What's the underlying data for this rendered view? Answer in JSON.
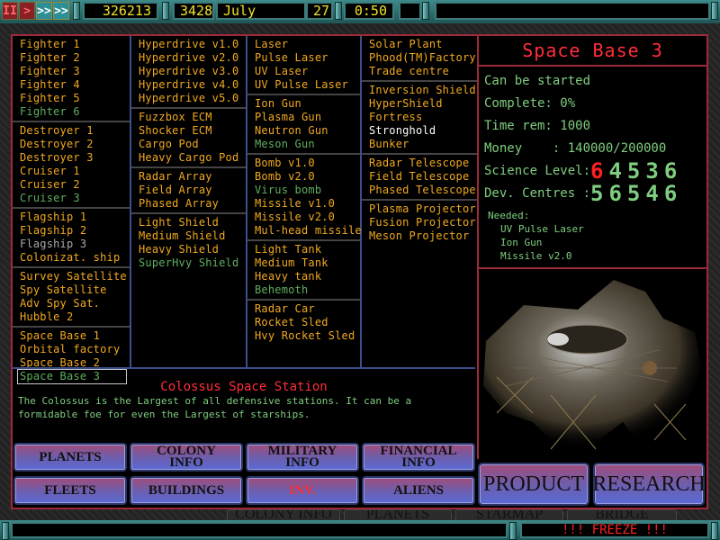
{
  "topbar": {
    "controls": [
      {
        "name": "pause",
        "glyph": "II"
      },
      {
        "name": "play",
        "glyph": ">"
      },
      {
        "name": "fast",
        "glyph": ">>"
      },
      {
        "name": "faster",
        "glyph": ">>"
      }
    ],
    "credits": "326213",
    "year": "3428",
    "month": "July",
    "day": "27",
    "time": "0:50",
    "message": ""
  },
  "columns": [
    {
      "groups": [
        [
          {
            "label": "Fighter 1",
            "state": "available"
          },
          {
            "label": "Fighter 2",
            "state": "available"
          },
          {
            "label": "Fighter 3",
            "state": "available"
          },
          {
            "label": "Fighter 4",
            "state": "available"
          },
          {
            "label": "Fighter 5",
            "state": "available"
          },
          {
            "label": "Fighter 6",
            "state": "researched"
          }
        ],
        [
          {
            "label": "Destroyer 1",
            "state": "available"
          },
          {
            "label": "Destroyer 2",
            "state": "available"
          },
          {
            "label": "Destroyer 3",
            "state": "available"
          },
          {
            "label": "Cruiser 1",
            "state": "available"
          },
          {
            "label": "Cruiser 2",
            "state": "available"
          },
          {
            "label": "Cruiser 3",
            "state": "researched"
          }
        ],
        [
          {
            "label": "Flagship 1",
            "state": "available"
          },
          {
            "label": "Flagship 2",
            "state": "available"
          },
          {
            "label": "Flagship 3",
            "state": "unavailable"
          },
          {
            "label": "Colonizat. ship",
            "state": "available"
          }
        ],
        [
          {
            "label": "Survey Satellite",
            "state": "available"
          },
          {
            "label": "Spy Satellite",
            "state": "available"
          },
          {
            "label": "Adv Spy Sat.",
            "state": "available"
          },
          {
            "label": "Hubble 2",
            "state": "available"
          }
        ],
        [
          {
            "label": "Space Base 1",
            "state": "available"
          },
          {
            "label": "Orbital factory",
            "state": "available"
          },
          {
            "label": "Space Base 2",
            "state": "available"
          },
          {
            "label": "Space Base 3",
            "state": "researched",
            "selected": true
          }
        ]
      ]
    },
    {
      "groups": [
        [
          {
            "label": "Hyperdrive v1.0",
            "state": "available"
          },
          {
            "label": "Hyperdrive v2.0",
            "state": "available"
          },
          {
            "label": "Hyperdrive v3.0",
            "state": "available"
          },
          {
            "label": "Hyperdrive v4.0",
            "state": "available"
          },
          {
            "label": "Hyperdrive v5.0",
            "state": "available"
          }
        ],
        [
          {
            "label": "Fuzzbox ECM",
            "state": "available"
          },
          {
            "label": "Shocker ECM",
            "state": "available"
          },
          {
            "label": "Cargo Pod",
            "state": "available"
          },
          {
            "label": "Heavy Cargo Pod",
            "state": "available"
          }
        ],
        [
          {
            "label": "Radar Array",
            "state": "available"
          },
          {
            "label": "Field Array",
            "state": "available"
          },
          {
            "label": "Phased Array",
            "state": "available"
          }
        ],
        [
          {
            "label": "Light Shield",
            "state": "available"
          },
          {
            "label": "Medium Shield",
            "state": "available"
          },
          {
            "label": "Heavy Shield",
            "state": "available"
          },
          {
            "label": "SuperHvy Shield",
            "state": "researched"
          }
        ]
      ]
    },
    {
      "groups": [
        [
          {
            "label": "Laser",
            "state": "available"
          },
          {
            "label": "Pulse Laser",
            "state": "available"
          },
          {
            "label": "UV Laser",
            "state": "available"
          },
          {
            "label": "UV Pulse Laser",
            "state": "available"
          }
        ],
        [
          {
            "label": "Ion Gun",
            "state": "available"
          },
          {
            "label": "Plasma Gun",
            "state": "available"
          },
          {
            "label": "Neutron Gun",
            "state": "available"
          },
          {
            "label": "Meson Gun",
            "state": "researched"
          }
        ],
        [
          {
            "label": "Bomb v1.0",
            "state": "available"
          },
          {
            "label": "Bomb v2.0",
            "state": "available"
          },
          {
            "label": "Virus bomb",
            "state": "researched"
          },
          {
            "label": "Missile v1.0",
            "state": "available"
          },
          {
            "label": "Missile v2.0",
            "state": "available"
          },
          {
            "label": "Mul-head missile",
            "state": "available"
          }
        ],
        [
          {
            "label": "Light Tank",
            "state": "available"
          },
          {
            "label": "Medium Tank",
            "state": "available"
          },
          {
            "label": "Heavy tank",
            "state": "available"
          },
          {
            "label": "Behemoth",
            "state": "researched"
          }
        ],
        [
          {
            "label": "Radar Car",
            "state": "available"
          },
          {
            "label": "Rocket Sled",
            "state": "available"
          },
          {
            "label": "Hvy Rocket Sled",
            "state": "available"
          }
        ]
      ]
    },
    {
      "groups": [
        [
          {
            "label": "Solar Plant",
            "state": "available"
          },
          {
            "label": "Phood(TM)Factory",
            "state": "available"
          },
          {
            "label": "Trade centre",
            "state": "available"
          }
        ],
        [
          {
            "label": "Inversion Shield",
            "state": "available"
          },
          {
            "label": "HyperShield",
            "state": "available"
          },
          {
            "label": "Fortress",
            "state": "available"
          },
          {
            "label": "Stronghold",
            "state": "highlighted"
          },
          {
            "label": "Bunker",
            "state": "available"
          }
        ],
        [
          {
            "label": "Radar Telescope",
            "state": "available"
          },
          {
            "label": "Field Telescope",
            "state": "available"
          },
          {
            "label": "Phased Telescope",
            "state": "available"
          }
        ],
        [
          {
            "label": "Plasma Projector",
            "state": "available"
          },
          {
            "label": "Fusion Projector",
            "state": "available"
          },
          {
            "label": "Meson Projector",
            "state": "available"
          }
        ]
      ]
    }
  ],
  "info": {
    "title": "Space Base 3",
    "status": "Can be started",
    "complete_label": "Complete: ",
    "complete_value": "0%",
    "time_label": "Time rem: ",
    "time_value": "1000",
    "money_label": "Money    : ",
    "money_value": "140000/200000",
    "science_label": "Science Level:",
    "science_digits": [
      {
        "d": "6",
        "short": true
      },
      {
        "d": "4",
        "short": false
      },
      {
        "d": "5",
        "short": false
      },
      {
        "d": "3",
        "short": false
      },
      {
        "d": "6",
        "short": false
      }
    ],
    "dev_label": "Dev. Centres :",
    "dev_digits": [
      "5",
      "6",
      "5",
      "4",
      "6"
    ],
    "needed_label": "Needed:",
    "needed": [
      "UV Pulse Laser",
      "Ion Gun",
      "Missile v2.0"
    ]
  },
  "description": {
    "title": "Colossus Space Station",
    "text": "The Colossus is the Largest of all defensive stations. It can be a formidable foe for even the Largest of starships."
  },
  "nav": {
    "row1": [
      "PLANETS",
      "COLONY\nINFO",
      "MILITARY\nINFO",
      "FINANCIAL\nINFO"
    ],
    "row2": [
      "FLEETS",
      "BUILDINGS",
      "INV.",
      "ALIENS"
    ],
    "active": "INV.",
    "product": "PRODUCT",
    "research": "RESEARCH"
  },
  "background_tabs": [
    "COLONY INFO",
    "PLANETS",
    "STARMAP",
    "BRIDGE"
  ],
  "status_bar": {
    "message": "",
    "freeze": "!!! FREEZE !!!"
  },
  "colors": {
    "available": "#f0a820",
    "researched": "#5fae5f",
    "unavailable": "#a8a8a8",
    "highlighted": "#ffffff",
    "title_red": "#ff2d3a",
    "info_green": "#7fce7f",
    "lcd_yellow": "#f2e02a"
  }
}
